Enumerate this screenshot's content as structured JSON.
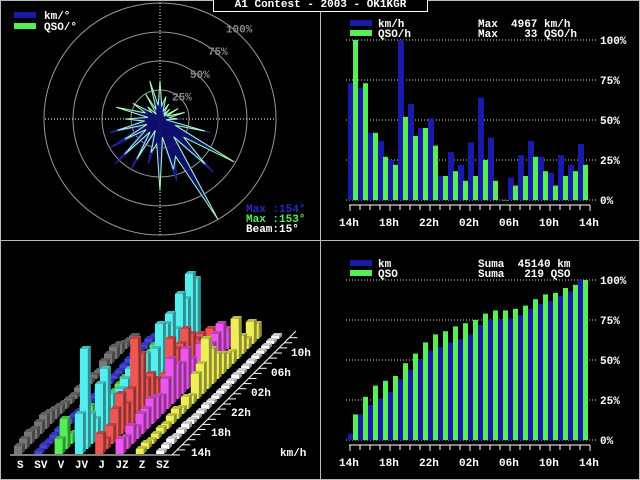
{
  "title": "A1 Contest - 2003 - OK1KGR",
  "colors": {
    "km": "#1a1aa8",
    "qso": "#55ee55",
    "grid": "#aaaaaa",
    "text": "#ffffff"
  },
  "chart_data": [
    {
      "type": "polar",
      "legend": [
        "km/°",
        "QSO/°"
      ],
      "ring_labels": [
        "25%",
        "50%",
        "75%",
        "100%"
      ],
      "bearings": [
        0,
        15,
        30,
        45,
        60,
        75,
        90,
        105,
        120,
        135,
        150,
        165,
        180,
        195,
        210,
        225,
        240,
        255,
        270,
        285,
        300,
        315,
        330,
        345
      ],
      "series": [
        {
          "name": "km/°",
          "values": [
            25,
            15,
            12,
            10,
            15,
            20,
            20,
            45,
            70,
            65,
            100,
            55,
            60,
            40,
            50,
            55,
            50,
            45,
            30,
            35,
            25,
            15,
            20,
            30
          ]
        },
        {
          "name": "QSO/°",
          "values": [
            33,
            20,
            15,
            12,
            18,
            22,
            15,
            40,
            74,
            55,
            100,
            45,
            62,
            30,
            40,
            43,
            35,
            38,
            30,
            39,
            27,
            15,
            25,
            34
          ]
        }
      ],
      "info": {
        "km_max": "Max :154°",
        "qso_max": "Max :153°",
        "beam": "Beam:15°"
      }
    },
    {
      "type": "bar",
      "legend": [
        "km/h",
        "QSO/h"
      ],
      "max_labels": [
        "Max  4967 km/h",
        "Max    33 QSO/h"
      ],
      "yticks": [
        "100%",
        "75%",
        "50%",
        "25%",
        "0%"
      ],
      "xlabels": [
        "14h",
        "18h",
        "22h",
        "02h",
        "06h",
        "10h",
        "14h"
      ],
      "ylim": [
        0,
        100
      ],
      "series": [
        {
          "name": "km/h",
          "values": [
            73,
            70,
            42,
            37,
            25,
            100,
            60,
            45,
            51,
            15,
            30,
            22,
            36,
            64,
            39,
            0,
            14,
            28,
            37,
            27,
            17,
            28,
            22,
            35
          ]
        },
        {
          "name": "QSO/h",
          "values": [
            100,
            73,
            42,
            27,
            22,
            52,
            40,
            45,
            34,
            15,
            18,
            12,
            15,
            25,
            12,
            0,
            9,
            15,
            27,
            18,
            9,
            15,
            18,
            22
          ]
        }
      ]
    },
    {
      "type": "bar3d",
      "directions": [
        "S",
        "SV",
        "V",
        "JV",
        "J",
        "JZ",
        "Z",
        "SZ"
      ],
      "hour_labels": [
        "14h",
        "18h",
        "22h",
        "02h",
        "06h",
        "10h"
      ],
      "unit": "km/h",
      "series_colors": [
        "#777777",
        "#4444dd",
        "#55ee55",
        "#55eeee",
        "#ee5555",
        "#ee55ee",
        "#eeee55",
        "#ffffff"
      ],
      "values": [
        [
          8,
          10,
          12,
          10,
          12,
          14,
          12,
          10,
          8,
          6,
          5,
          4,
          6,
          5,
          4,
          4,
          3,
          8,
          10,
          12,
          10,
          6,
          4,
          3
        ],
        [
          3,
          4,
          3,
          4,
          5,
          6,
          5,
          4,
          3,
          4,
          3,
          3,
          4,
          4,
          3,
          3,
          3,
          4,
          5,
          6,
          4,
          4,
          5,
          3
        ],
        [
          15,
          30,
          10,
          6,
          12,
          24,
          18,
          10,
          8,
          6,
          6,
          8,
          10,
          12,
          8,
          10,
          8,
          6,
          12,
          14,
          10,
          20,
          8,
          6
        ],
        [
          40,
          100,
          30,
          20,
          50,
          60,
          30,
          20,
          25,
          30,
          35,
          40,
          20,
          35,
          10,
          30,
          50,
          45,
          50,
          30,
          60,
          50,
          70,
          60
        ],
        [
          20,
          10,
          18,
          30,
          40,
          25,
          35,
          80,
          60,
          30,
          30,
          20,
          10,
          15,
          45,
          30,
          30,
          40,
          30,
          20,
          20,
          10,
          15,
          10
        ],
        [
          15,
          12,
          18,
          12,
          20,
          20,
          25,
          22,
          18,
          30,
          45,
          35,
          30,
          40,
          25,
          15,
          30,
          20,
          20,
          25,
          30,
          20,
          15,
          20
        ],
        [
          5,
          6,
          4,
          5,
          6,
          5,
          8,
          10,
          6,
          12,
          8,
          25,
          30,
          50,
          35,
          25,
          20,
          15,
          12,
          40,
          18,
          10,
          22,
          15
        ],
        [
          3,
          4,
          5,
          3,
          4,
          5,
          4,
          3,
          3,
          4,
          3,
          3,
          3,
          3,
          3,
          4,
          3,
          3,
          3,
          3,
          3,
          3,
          3,
          3
        ]
      ]
    },
    {
      "type": "bar",
      "legend": [
        "km",
        "QSO"
      ],
      "sum_labels": [
        "Suma  45140 km",
        "Suma   219 QSO"
      ],
      "yticks": [
        "100%",
        "75%",
        "50%",
        "25%",
        "0%"
      ],
      "xlabels": [
        "14h",
        "18h",
        "22h",
        "02h",
        "06h",
        "10h",
        "14h"
      ],
      "ylim": [
        0,
        100
      ],
      "series": [
        {
          "name": "km",
          "values": [
            4,
            16,
            22,
            26,
            30,
            38,
            44,
            50,
            56,
            58,
            61,
            63,
            66,
            72,
            75,
            75,
            76,
            78,
            82,
            85,
            87,
            90,
            93,
            100
          ]
        },
        {
          "name": "QSO",
          "values": [
            16,
            27,
            34,
            37,
            40,
            48,
            54,
            61,
            66,
            68,
            71,
            73,
            75,
            79,
            81,
            81,
            82,
            84,
            88,
            91,
            92,
            95,
            97,
            100
          ]
        }
      ]
    }
  ]
}
